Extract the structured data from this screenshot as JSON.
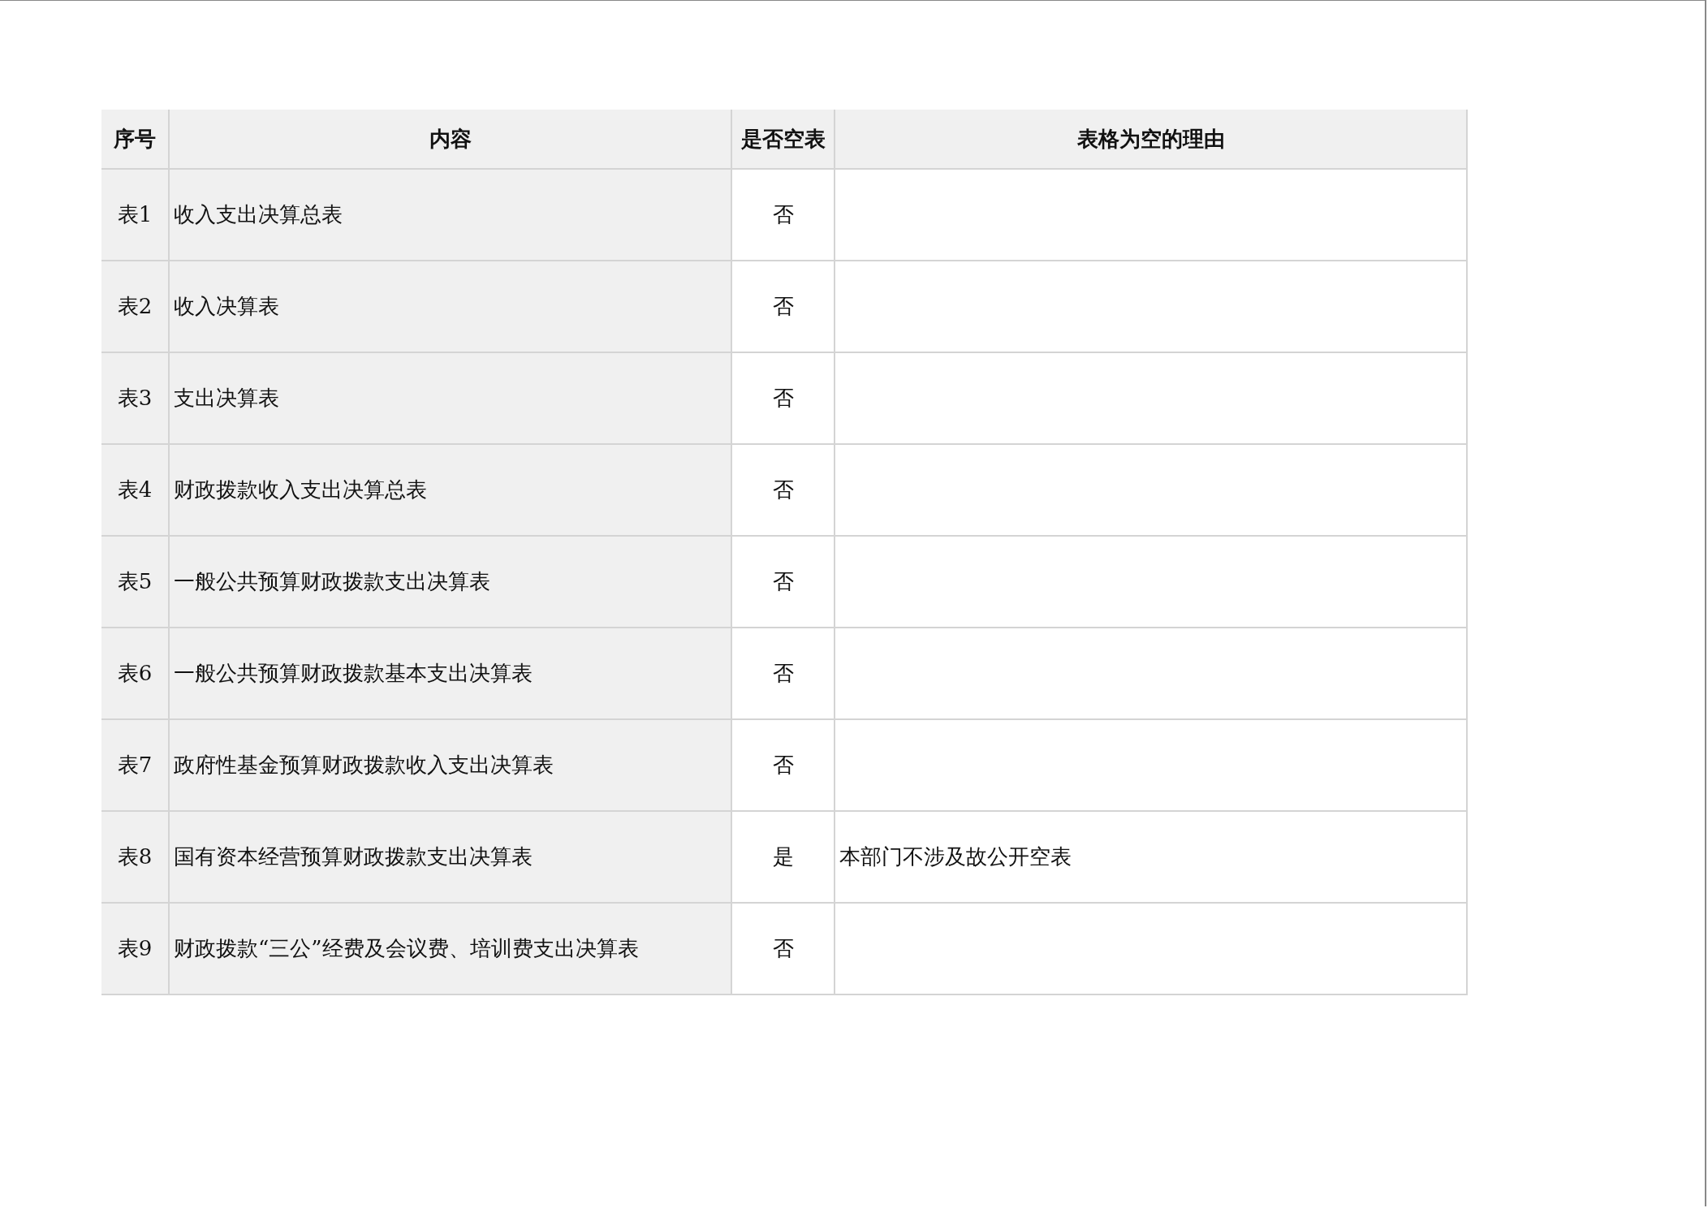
{
  "table": {
    "columns": [
      "序号",
      "内容",
      "是否空表",
      "表格为空的理由"
    ],
    "rows": [
      {
        "index": "表1",
        "content": "收入支出决算总表",
        "is_empty": "否"
      },
      {
        "index": "表2",
        "content": "收入决算表",
        "is_empty": "否"
      },
      {
        "index": "表3",
        "content": "支出决算表",
        "is_empty": "否"
      },
      {
        "index": "表4",
        "content": "财政拨款收入支出决算总表",
        "is_empty": "否"
      },
      {
        "index": "表5",
        "content": "一般公共预算财政拨款支出决算表",
        "is_empty": "否"
      },
      {
        "index": "表6",
        "content": "一般公共预算财政拨款基本支出决算表",
        "is_empty": "否"
      },
      {
        "index": "表7",
        "content": "政府性基金预算财政拨款收入支出决算表",
        "is_empty": "否"
      },
      {
        "index": "表8",
        "content": "国有资本经营预算财政拨款支出决算表",
        "is_empty": "是",
        "reason": "本部门不涉及故公开空表"
      },
      {
        "index": "表9",
        "content": "财政拨款“三公”经费及会议费、培训费支出决算表",
        "is_empty": "否"
      }
    ]
  }
}
